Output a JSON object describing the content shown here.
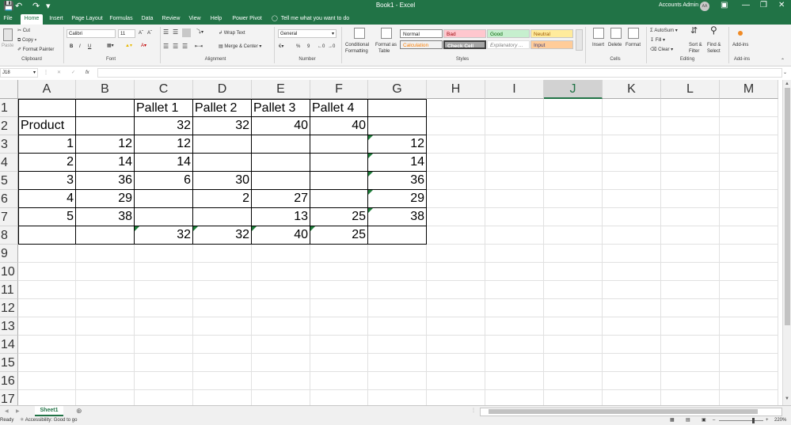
{
  "window": {
    "title": "Book1  -  Excel",
    "account": "Accounts Admin",
    "avatar_initials": "AA"
  },
  "quick_access": {
    "save_icon": "save-icon",
    "undo_icon": "undo-icon",
    "redo_icon": "redo-icon"
  },
  "tabs": [
    {
      "label": "File"
    },
    {
      "label": "Home"
    },
    {
      "label": "Insert"
    },
    {
      "label": "Page Layout"
    },
    {
      "label": "Formulas"
    },
    {
      "label": "Data"
    },
    {
      "label": "Review"
    },
    {
      "label": "View"
    },
    {
      "label": "Help"
    },
    {
      "label": "Power Pivot"
    }
  ],
  "tell_me": "Tell me what you want to do",
  "ribbon": {
    "clipboard": {
      "paste": "Paste",
      "cut": "Cut",
      "copy": "Copy",
      "format_painter": "Format Painter",
      "label": "Clipboard"
    },
    "font": {
      "name": "Calibri",
      "size": "11",
      "bold": "B",
      "italic": "I",
      "underline": "U",
      "label": "Font"
    },
    "alignment": {
      "wrap": "Wrap Text",
      "merge": "Merge & Center",
      "label": "Alignment"
    },
    "number": {
      "format": "General",
      "percent": "%",
      "comma": "9",
      "label": "Number"
    },
    "styles": {
      "conditional": "Conditional",
      "conditional2": "Formatting",
      "format_as": "Format as",
      "format_as2": "Table",
      "normal": "Normal",
      "bad": "Bad",
      "good": "Good",
      "neutral": "Neutral",
      "calculation": "Calculation",
      "check_cell": "Check Cell",
      "explanatory": "Explanatory ...",
      "input": "Input",
      "label": "Styles"
    },
    "cells": {
      "insert": "Insert",
      "delete": "Delete",
      "format": "Format",
      "label": "Cells"
    },
    "editing": {
      "autosum": "AutoSum",
      "fill": "Fill",
      "clear": "Clear",
      "sort": "Sort &",
      "sort2": "Filter",
      "find": "Find &",
      "find2": "Select",
      "label": "Editing"
    },
    "addins": {
      "label": "Add-ins",
      "button": "Add-ins"
    }
  },
  "formula_bar": {
    "name_box": "J18",
    "fx": "fx",
    "content": ""
  },
  "columns": [
    "A",
    "B",
    "C",
    "D",
    "E",
    "F",
    "G",
    "H",
    "I",
    "J",
    "K",
    "L",
    "M"
  ],
  "selected_column": "J",
  "rows": [
    "1",
    "2",
    "3",
    "4",
    "5",
    "6",
    "7",
    "8",
    "9",
    "10",
    "11",
    "12",
    "13",
    "14",
    "15",
    "16",
    "17"
  ],
  "cells": {
    "C1": "Pallet 1",
    "D1": "Pallet 2",
    "E1": "Pallet 3",
    "F1": "Pallet 4",
    "A2": "Product",
    "C2": "32",
    "D2": "32",
    "E2": "40",
    "F2": "40",
    "A3": "1",
    "B3": "12",
    "C3": "12",
    "G3": "12",
    "A4": "2",
    "B4": "14",
    "C4": "14",
    "G4": "14",
    "A5": "3",
    "B5": "36",
    "C5": "6",
    "D5": "30",
    "G5": "36",
    "A6": "4",
    "B6": "29",
    "D6": "2",
    "E6": "27",
    "G6": "29",
    "A7": "5",
    "B7": "38",
    "E7": "13",
    "F7": "25",
    "G7": "38",
    "C8": "32",
    "D8": "32",
    "E8": "40",
    "F8": "25"
  },
  "formula_flags": [
    "G3",
    "G4",
    "G5",
    "G6",
    "G7",
    "C8",
    "D8",
    "E8",
    "F8"
  ],
  "sheets": [
    {
      "name": "Sheet1"
    }
  ],
  "status": {
    "ready": "Ready",
    "accessibility": "Accessibility: Good to go",
    "zoom": "220%"
  },
  "colors": {
    "accent": "#217346",
    "formula_flag": "#1e7d3a"
  }
}
